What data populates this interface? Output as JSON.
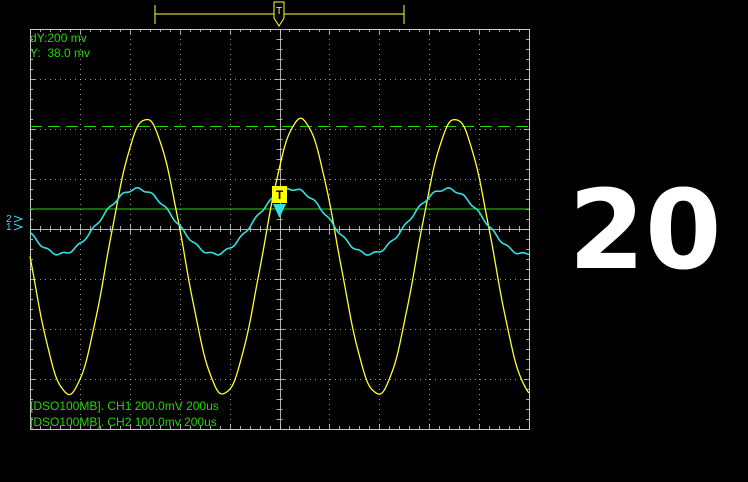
{
  "readouts": {
    "dy": "dY:200 mv",
    "y": "Y:  38.0 mv",
    "ch1_status": "[DSO100MB]. CH1 200.0mV 200us",
    "ch2_status": "[DSO100MB]. CH2 100.0mv 200us"
  },
  "markers": {
    "top_trigger": "T",
    "trigger_badge": "T",
    "ch2_marker": "2",
    "ch1_marker": "1"
  },
  "big_number": "20",
  "colors": {
    "background": "#000000",
    "grid": "#c8c8c8",
    "text": "#22d600",
    "ch1": "#ffff33",
    "ch2": "#33e0e0",
    "cursor": "#22d600",
    "trigger": "#ffff00"
  },
  "traces": {
    "ch1": {
      "amplitude_div": 2.75,
      "offset_div": -0.55,
      "period_div": 3.1,
      "phase_deg": 180
    },
    "ch2": {
      "amplitude_div": 0.65,
      "offset_div": 0.15,
      "period_div": 3.1,
      "phase_deg": 200
    }
  },
  "cursor_level_div": 2.05,
  "trigger_level_div": 0.4
}
